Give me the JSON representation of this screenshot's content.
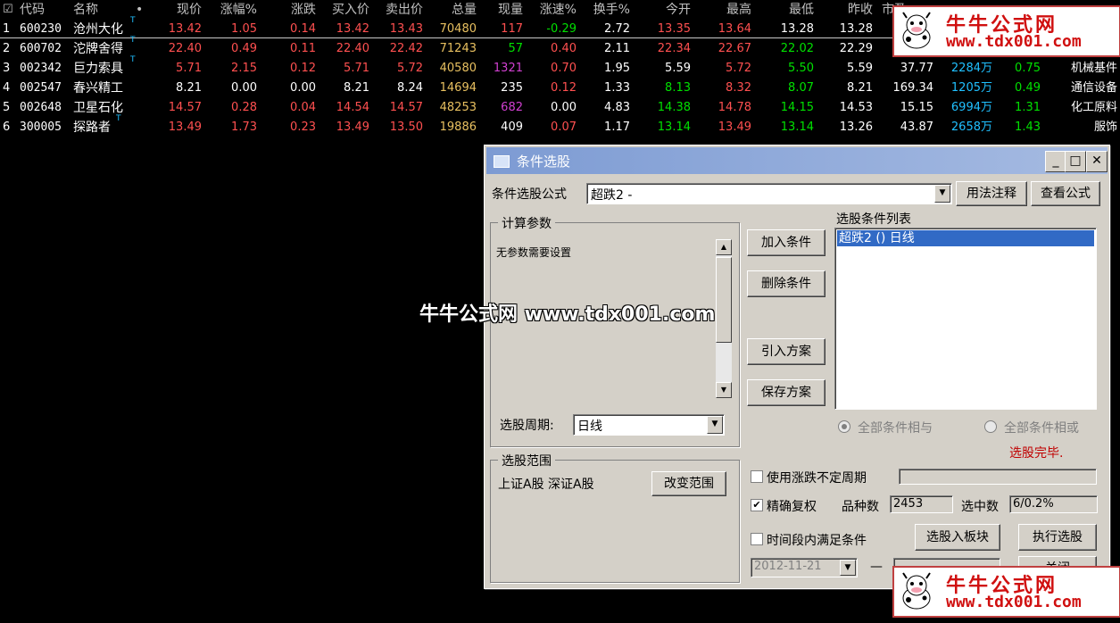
{
  "table": {
    "headers": {
      "code": "代码",
      "name": "名称",
      "dot": "•",
      "price": "现价",
      "chg_pct": "涨幅%",
      "chg": "涨跌",
      "bid": "买入价",
      "ask": "卖出价",
      "volume": "总量",
      "cur_vol": "现量",
      "speed": "涨速%",
      "turnover": "换手%",
      "open": "今开",
      "high": "最高",
      "low": "最低",
      "prev_close": "昨收",
      "pe": "市盈"
    },
    "rows": [
      {
        "idx": "1",
        "code": "600230",
        "name": "沧州大化",
        "flag": "T",
        "price": "13.42",
        "chg_pct": "1.05",
        "chg": "0.14",
        "bid": "13.42",
        "ask": "13.43",
        "volume": "70480",
        "cur_vol": "117",
        "speed": "-0.29",
        "turnover": "2.72",
        "open": "13.35",
        "high": "13.64",
        "low": "13.28",
        "prev_close": "13.28",
        "pe": "",
        "amount": "",
        "ratio": "",
        "industry": ""
      },
      {
        "idx": "2",
        "code": "600702",
        "name": "沱牌舍得",
        "flag": "T",
        "price": "22.40",
        "chg_pct": "0.49",
        "chg": "0.11",
        "bid": "22.40",
        "ask": "22.42",
        "volume": "71243",
        "cur_vol": "57",
        "speed": "0.40",
        "turnover": "2.11",
        "open": "22.34",
        "high": "22.67",
        "low": "22.02",
        "prev_close": "22.29",
        "pe": "",
        "amount": "",
        "ratio": "",
        "industry": ""
      },
      {
        "idx": "3",
        "code": "002342",
        "name": "巨力索具",
        "flag": "T",
        "price": "5.71",
        "chg_pct": "2.15",
        "chg": "0.12",
        "bid": "5.71",
        "ask": "5.72",
        "volume": "40580",
        "cur_vol": "1321",
        "speed": "0.70",
        "turnover": "1.95",
        "open": "5.59",
        "high": "5.72",
        "low": "5.50",
        "prev_close": "5.59",
        "pe": "37.77",
        "amount": "2284万",
        "ratio": "0.75",
        "industry": "机械基件"
      },
      {
        "idx": "4",
        "code": "002547",
        "name": "春兴精工",
        "flag": "",
        "price": "8.21",
        "chg_pct": "0.00",
        "chg": "0.00",
        "bid": "8.21",
        "ask": "8.24",
        "volume": "14694",
        "cur_vol": "235",
        "speed": "0.12",
        "turnover": "1.33",
        "open": "8.13",
        "high": "8.32",
        "low": "8.07",
        "prev_close": "8.21",
        "pe": "169.34",
        "amount": "1205万",
        "ratio": "0.49",
        "industry": "通信设备"
      },
      {
        "idx": "5",
        "code": "002648",
        "name": "卫星石化",
        "flag": "",
        "price": "14.57",
        "chg_pct": "0.28",
        "chg": "0.04",
        "bid": "14.54",
        "ask": "14.57",
        "volume": "48253",
        "cur_vol": "682",
        "speed": "0.00",
        "turnover": "4.83",
        "open": "14.38",
        "high": "14.78",
        "low": "14.15",
        "prev_close": "14.53",
        "pe": "15.15",
        "amount": "6994万",
        "ratio": "1.31",
        "industry": "化工原料"
      },
      {
        "idx": "6",
        "code": "300005",
        "name": "探路者",
        "flag": "T",
        "price": "13.49",
        "chg_pct": "1.73",
        "chg": "0.23",
        "bid": "13.49",
        "ask": "13.50",
        "volume": "19886",
        "cur_vol": "409",
        "speed": "0.07",
        "turnover": "1.17",
        "open": "13.14",
        "high": "13.49",
        "low": "13.14",
        "prev_close": "13.26",
        "pe": "43.87",
        "amount": "2658万",
        "ratio": "1.43",
        "industry": "服饰"
      }
    ]
  },
  "dialog": {
    "title": "条件选股",
    "formula_label": "条件选股公式",
    "formula_value": "超跌2      -",
    "usage_button": "用法注释",
    "view_formula_button": "查看公式",
    "params_group": "计算参数",
    "params_text": "无参数需要设置",
    "period_label": "选股周期:",
    "period_value": "日线",
    "add_condition": "加入条件",
    "delete_condition": "删除条件",
    "import_plan": "引入方案",
    "save_plan": "保存方案",
    "condition_list_label": "选股条件列表",
    "condition_items": [
      "超跌2 () 日线"
    ],
    "radio_and": "全部条件相与",
    "radio_or": "全部条件相或",
    "status": "选股完毕.",
    "range_group": "选股范围",
    "range_text": "上证A股 深证A股",
    "change_range": "改变范围",
    "use_variable_period": "使用涨跌不定周期",
    "precise_adjust": "精确复权",
    "count_label": "品种数",
    "count_value": "2453",
    "selected_label": "选中数",
    "selected_value": "6/0.2%",
    "to_block": "选股入板块",
    "run": "执行选股",
    "time_cond": "时间段内满足条件",
    "date_from": "2012-11-21",
    "dash": "—",
    "close": "关闭"
  },
  "watermark": {
    "site_name": "牛牛公式网",
    "url": "www.tdx001.com",
    "center": "牛牛公式网  www.tdx001.com"
  },
  "colors": {
    "up": "#ff5050",
    "down": "#00e000",
    "title_bar": "#7d9bd3",
    "status": "#c00000"
  }
}
